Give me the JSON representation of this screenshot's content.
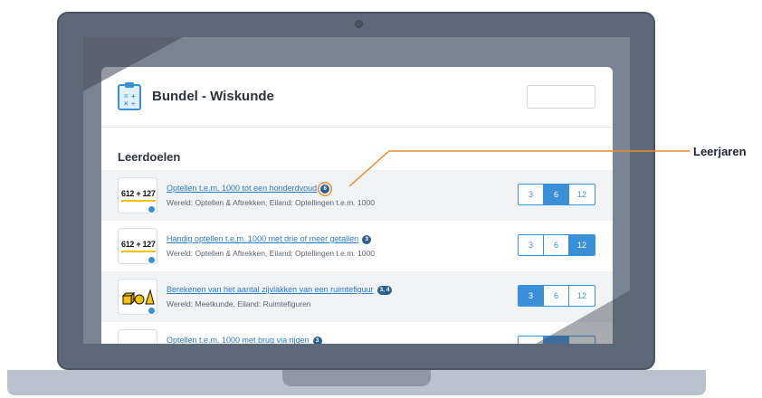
{
  "app": {
    "title": "Bundel - Wiskunde",
    "search_value": ""
  },
  "section": {
    "title": "Leerdoelen"
  },
  "callout": {
    "label": "Leerjaren"
  },
  "colors": {
    "accent": "#3a8fd9",
    "link": "#2a7ac6",
    "badge": "#2d5f8e",
    "callout": "#f08a24"
  },
  "goals": [
    {
      "thumb_text": "612 + 127",
      "title": "Optellen t.e.m. 1000 tot een honderdvoud",
      "badge": "6",
      "subtitle": "Wereld: Optellen & Aftrekken, Eiland: Optellingen t.e.m. 1000",
      "years": [
        "3",
        "6",
        "12"
      ],
      "active_year": "6"
    },
    {
      "thumb_text": "612 + 127",
      "title": "Handig optellen t.e.m. 1000 met drie of meer getallen",
      "badge": "3",
      "subtitle": "Wereld: Optellen & Aftrekken, Eiland: Optellingen t.e.m. 1000",
      "years": [
        "3",
        "6",
        "12"
      ],
      "active_year": "12"
    },
    {
      "thumb_icon": "geometric-shapes-icon",
      "title": "Berekenen van het aantal zijvlakken van een ruimtefiguur",
      "badge": "3, 4",
      "subtitle": "Wereld: Meetkunde, Eiland: Ruimtefiguren",
      "years": [
        "3",
        "6",
        "12"
      ],
      "active_year": "3"
    },
    {
      "title": "Optellen t.e.m. 1000 met brug via rijgen",
      "badge": "3",
      "active_year": "6"
    }
  ]
}
